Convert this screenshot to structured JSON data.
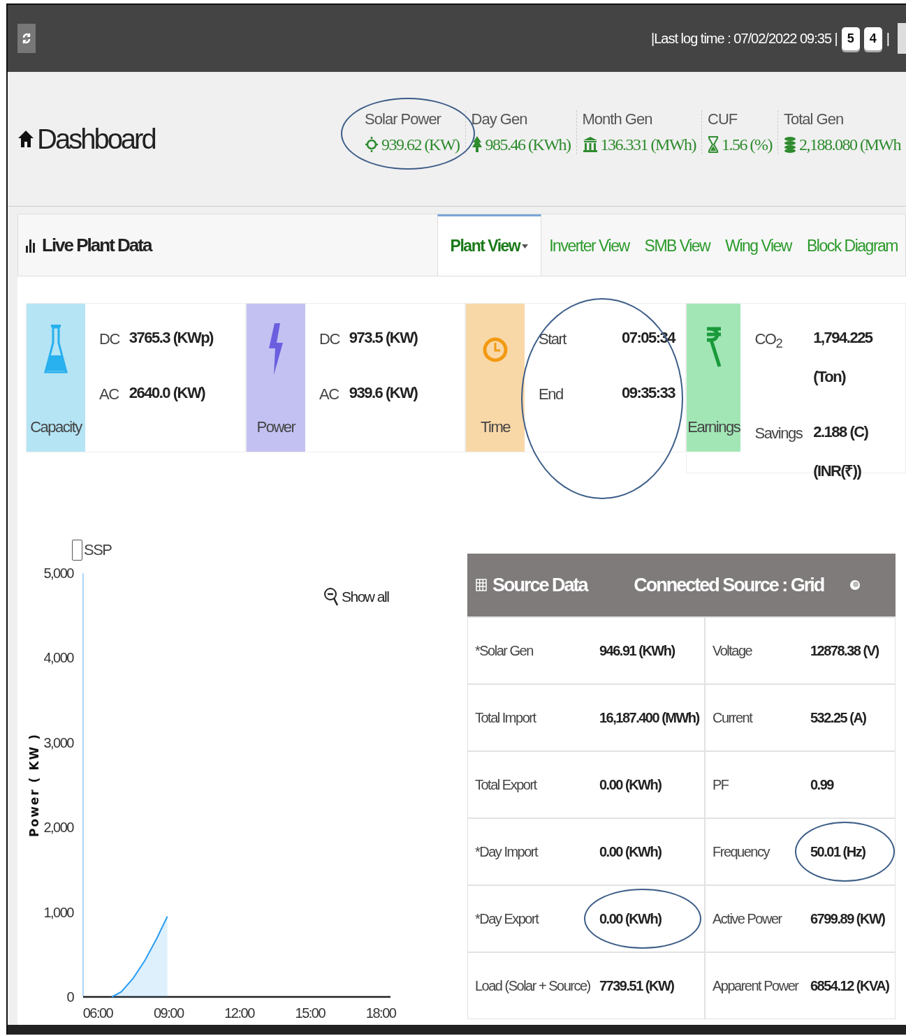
{
  "top_bar": {
    "log_time": "|Last log time : 07/02/2022 09:35 |",
    "keys": [
      "5",
      "4"
    ],
    "separator": "|"
  },
  "header": {
    "title": "Dashboard",
    "stats": [
      {
        "label": "Solar Power",
        "value": "939.62 (KW)",
        "circled": true
      },
      {
        "label": "Day Gen",
        "value": "985.46 (KWh)",
        "circled": false
      },
      {
        "label": "Month Gen",
        "value": "136.331 (MWh)",
        "circled": false
      },
      {
        "label": "CUF",
        "value": "1.56 (%)",
        "circled": false
      },
      {
        "label": "Total Gen",
        "value": "2,188.080 (MWh",
        "circled": false
      }
    ]
  },
  "panel": {
    "title": "Live Plant Data",
    "tabs": [
      {
        "label": "Plant View",
        "selected": true,
        "dropdown": true
      },
      {
        "label": "Inverter View",
        "selected": false,
        "dropdown": false
      },
      {
        "label": "SMB View",
        "selected": false,
        "dropdown": false
      },
      {
        "label": "Wing View",
        "selected": false,
        "dropdown": false
      },
      {
        "label": "Block Diagram",
        "selected": false,
        "dropdown": false
      }
    ],
    "cards": [
      {
        "label": "Capacity",
        "color": "#b5e4f5",
        "circled": false,
        "rows": [
          {
            "name": "DC",
            "value": "3765.3 (KWp)"
          },
          {
            "name": "AC",
            "value": "2640.0 (KW)"
          }
        ]
      },
      {
        "label": "Power",
        "color": "#c3c1f2",
        "circled": false,
        "rows": [
          {
            "name": "DC",
            "value": "973.5 (KW)"
          },
          {
            "name": "AC",
            "value": "939.6 (KW)"
          }
        ]
      },
      {
        "label": "Time",
        "color": "#f9d8a8",
        "circled": true,
        "rows": [
          {
            "name": "Start",
            "value": "07:05:34"
          },
          {
            "name": "End",
            "value": "09:35:33"
          }
        ]
      },
      {
        "label": "Earnings",
        "color": "#a2e6b6",
        "circled": false,
        "rows": [
          {
            "name": "CO$_{2}$",
            "value": "1,794.225 (Ton)"
          },
          {
            "name": "Savings",
            "value": "2.188 (C) (INR(₹))"
          }
        ]
      }
    ]
  },
  "chart": {
    "legend": {
      "label": "SSP",
      "checked": false
    },
    "show_all": "Show all",
    "chart_data": {
      "type": "area",
      "ylabel": "Power ( KW )",
      "x": [
        6.6,
        7,
        7.5,
        8,
        8.5,
        8.95
      ],
      "series": [
        {
          "color": "#2a9df4",
          "values": [
            0,
            60,
            220,
            430,
            690,
            950
          ]
        }
      ],
      "xlim": [
        5.38,
        18.41
      ],
      "ylim": [
        0,
        5000
      ],
      "xticks": [
        {
          "value": 6,
          "label": "06:00"
        },
        {
          "value": 9,
          "label": "09:00"
        },
        {
          "value": 12,
          "label": "12:00"
        },
        {
          "value": 15,
          "label": "15:00"
        },
        {
          "value": 18,
          "label": "18:00"
        }
      ],
      "yticks": [
        {
          "value": 0,
          "label": "0"
        },
        {
          "value": 1000,
          "label": "1,000"
        },
        {
          "value": 2000,
          "label": "2,000"
        },
        {
          "value": 3000,
          "label": "3,000"
        },
        {
          "value": 4000,
          "label": "4,000"
        },
        {
          "value": 5000,
          "label": "5,000"
        }
      ]
    }
  },
  "source_table": {
    "title": "Source Data",
    "connected": "Connected Source : Grid",
    "rows": [
      [
        {
          "text": "*Solar Gen",
          "circled": false
        },
        {
          "text": "946.91 (KWh)",
          "circled": false
        },
        {
          "text": "Voltage",
          "circled": false
        },
        {
          "text": "12878.38 (V)",
          "circled": false
        }
      ],
      [
        {
          "text": "Total Import",
          "circled": false
        },
        {
          "text": "16,187.400 (MWh)",
          "circled": false
        },
        {
          "text": "Current",
          "circled": false
        },
        {
          "text": "532.25 (A)",
          "circled": false
        }
      ],
      [
        {
          "text": "Total Export",
          "circled": false
        },
        {
          "text": "0.00 (KWh)",
          "circled": false
        },
        {
          "text": "PF",
          "circled": false
        },
        {
          "text": "0.99",
          "circled": false
        }
      ],
      [
        {
          "text": "*Day Import",
          "circled": false
        },
        {
          "text": "0.00 (KWh)",
          "circled": false
        },
        {
          "text": "Frequency",
          "circled": false
        },
        {
          "text": "50.01 (Hz)",
          "circled": true
        }
      ],
      [
        {
          "text": "*Day Export",
          "circled": false
        },
        {
          "text": "0.00 (KWh)",
          "circled": true
        },
        {
          "text": "Active Power",
          "circled": false
        },
        {
          "text": "6799.89 (KW)",
          "circled": false
        }
      ],
      [
        {
          "text": "Load (Solar + Source)",
          "circled": false
        },
        {
          "text": "7739.51 (KW)",
          "circled": false
        },
        {
          "text": "Apparent Power",
          "circled": false
        },
        {
          "text": "6854.12 (KVA)",
          "circled": false
        }
      ]
    ]
  }
}
